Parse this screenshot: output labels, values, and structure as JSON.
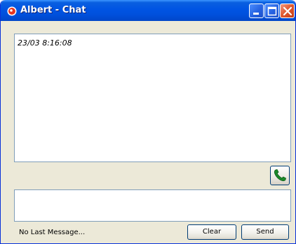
{
  "window": {
    "title": "Albert - Chat",
    "titlebar_color": "#0054e3",
    "icons": [
      "app-icon",
      "minimize-icon",
      "maximize-icon",
      "close-icon"
    ]
  },
  "chat": {
    "messages": [
      "23/03 8:16:08"
    ]
  },
  "call_button": {
    "icon": "phone-icon",
    "icon_color": "#1c8a2b"
  },
  "message_input": {
    "value": ""
  },
  "status": {
    "text": "No Last Message..."
  },
  "buttons": {
    "clear_label": "Clear",
    "send_label": "Send"
  }
}
